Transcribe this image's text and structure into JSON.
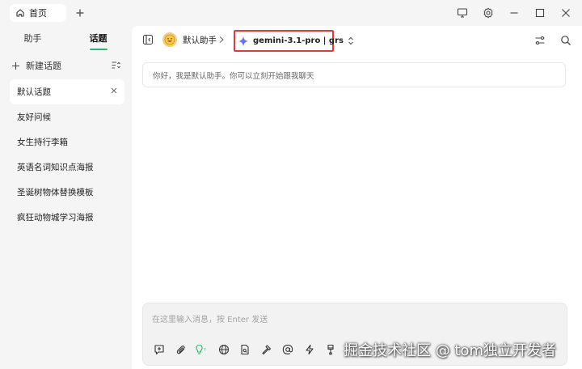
{
  "titlebar": {
    "home_tab": "首页"
  },
  "sidebar": {
    "tabs": [
      {
        "label": "助手",
        "active": false
      },
      {
        "label": "话题",
        "active": true
      }
    ],
    "new_topic": "新建话题",
    "topics": [
      {
        "label": "默认话题",
        "active": true
      },
      {
        "label": "友好问候",
        "active": false
      },
      {
        "label": "女生持行李箱",
        "active": false
      },
      {
        "label": "英语名词知识点海报",
        "active": false
      },
      {
        "label": "圣诞树物体替换模板",
        "active": false
      },
      {
        "label": "疯狂动物城学习海报",
        "active": false
      }
    ]
  },
  "header": {
    "assistant_name": "默认助手",
    "model": "gemini-3.1-pro | grs"
  },
  "chat": {
    "welcome": "你好，我是默认助手。你可以立刻开始跟我聊天"
  },
  "composer": {
    "placeholder": "在这里输入消息，按 Enter 发送"
  },
  "watermark": "掘金技术社区 @ tom独立开发者",
  "colors": {
    "accent": "#2bb673",
    "highlight_border": "#e53935"
  }
}
